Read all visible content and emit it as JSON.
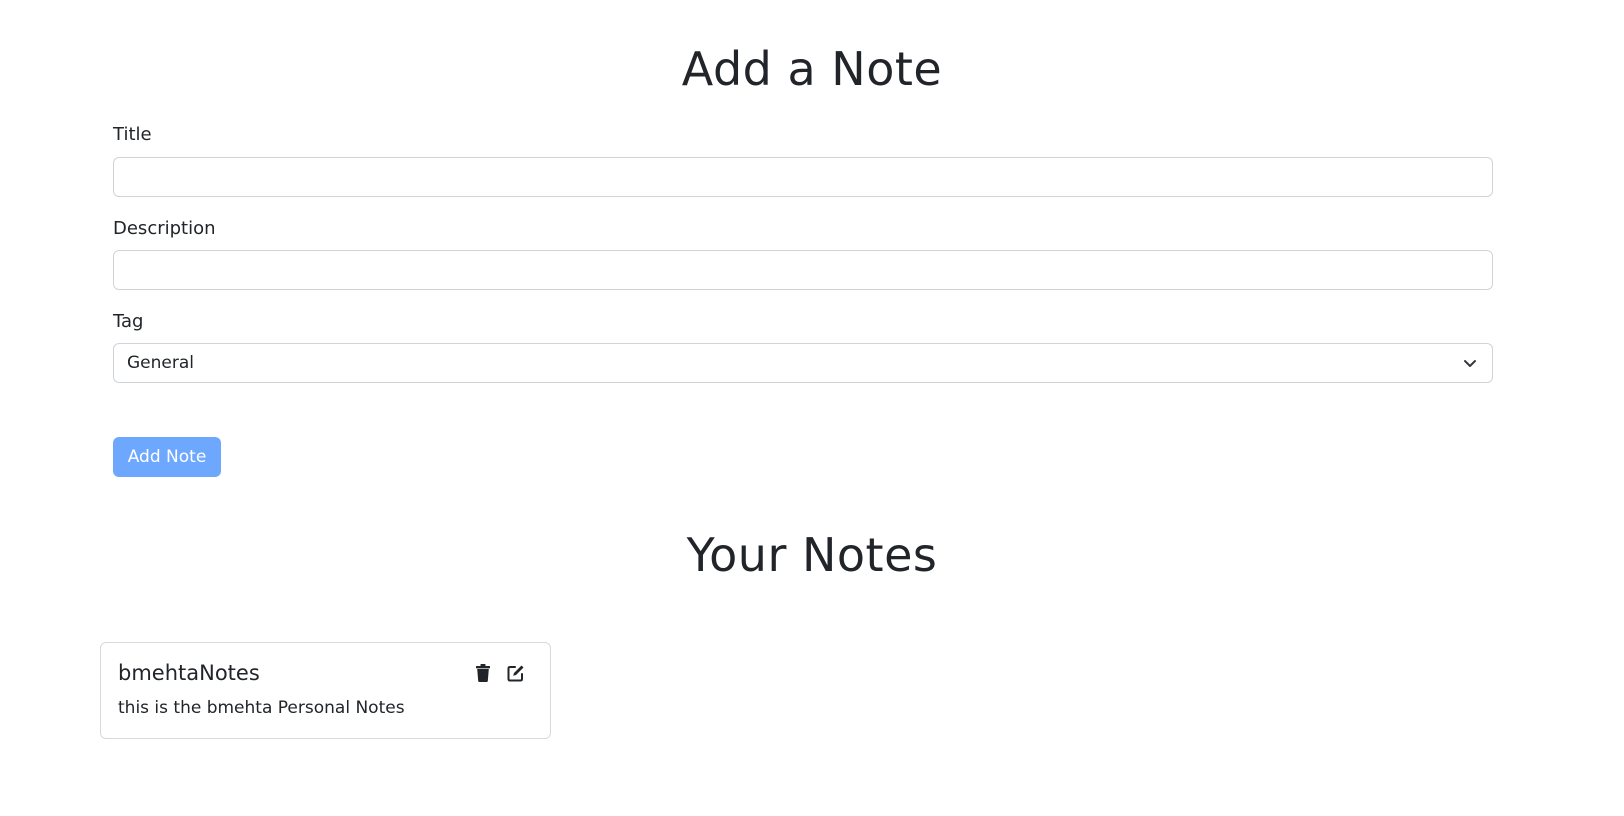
{
  "form": {
    "heading": "Add a Note",
    "title_label": "Title",
    "title_value": "",
    "description_label": "Description",
    "description_value": "",
    "tag_label": "Tag",
    "tag_selected": "General",
    "submit_label": "Add Note",
    "submit_color": "#6ea8fe"
  },
  "notes": {
    "heading": "Your Notes",
    "items": [
      {
        "title": "bmehtaNotes",
        "description": "this is the bmehta Personal Notes",
        "icons": [
          "trash-icon",
          "edit-icon"
        ]
      }
    ]
  }
}
